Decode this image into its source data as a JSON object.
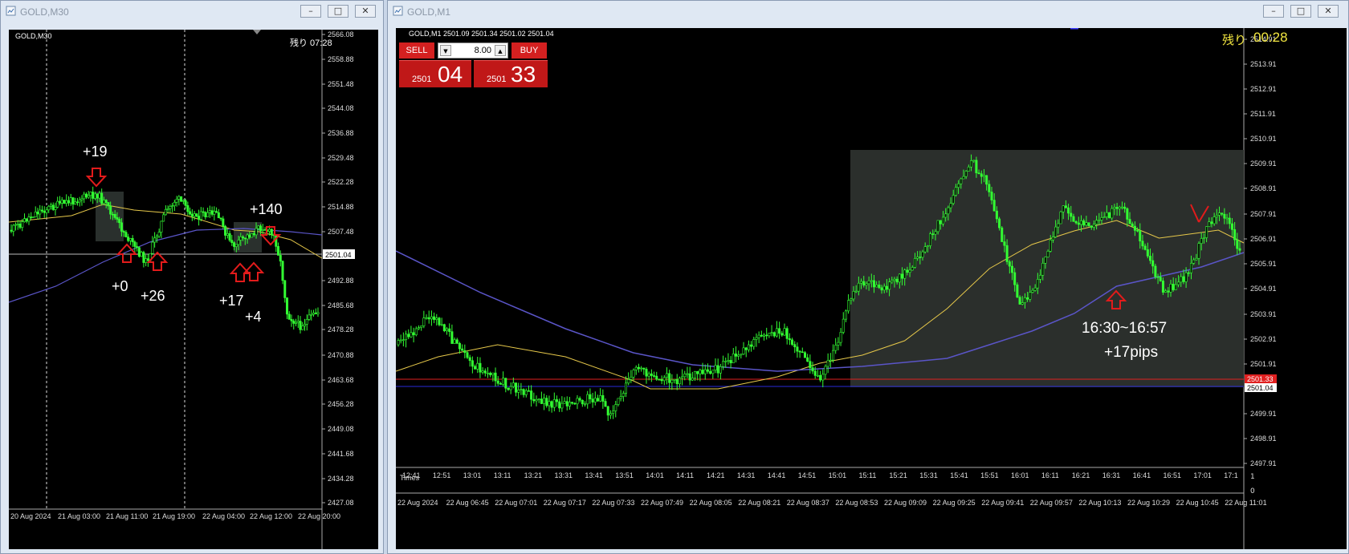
{
  "left_window": {
    "title": "GOLD,M30",
    "chart_label": "GOLD,M30",
    "remaining": "残り 07:28",
    "price_ticks": [
      "2566.08",
      "2558.88",
      "2551.48",
      "2544.08",
      "2536.88",
      "2529.48",
      "2522.28",
      "2514.88",
      "2507.48",
      "2492.88",
      "2485.68",
      "2478.28",
      "2470.88",
      "2463.68",
      "2456.28",
      "2449.08",
      "2441.68",
      "2434.28",
      "2427.08"
    ],
    "current_price": "2501.04",
    "time_ticks": [
      "20 Aug 2024",
      "21 Aug 03:00",
      "21 Aug 11:00",
      "21 Aug 19:00",
      "22 Aug 04:00",
      "22 Aug 12:00",
      "22 Aug 20:00"
    ],
    "annotations": [
      "+19",
      "+0",
      "+26",
      "+140",
      "+17",
      "+4"
    ]
  },
  "right_window": {
    "title": "GOLD,M1",
    "chart_label": "GOLD,M1  2501.09 2501.34 2501.02 2501.04",
    "remaining_label": "残り",
    "remaining_time": "00:28",
    "trade": {
      "sell_label": "SELL",
      "buy_label": "BUY",
      "lot": "8.00",
      "sell_small": "2501",
      "sell_big": "04",
      "buy_small": "2501",
      "buy_big": "33"
    },
    "price_ticks": [
      "2514.91",
      "2513.91",
      "2512.91",
      "2511.91",
      "2510.91",
      "2509.91",
      "2508.91",
      "2507.91",
      "2506.91",
      "2505.91",
      "2504.91",
      "2503.91",
      "2502.91",
      "2501.91",
      "2499.91",
      "2498.91",
      "2497.91"
    ],
    "ask_price": "2501.33",
    "bid_price": "2501.04",
    "session_ticks": [
      "12:41",
      "12:51",
      "13:01",
      "13:11",
      "13:21",
      "13:31",
      "13:41",
      "13:51",
      "14:01",
      "14:11",
      "14:21",
      "14:31",
      "14:41",
      "14:51",
      "15:01",
      "15:11",
      "15:21",
      "15:31",
      "15:41",
      "15:51",
      "16:01",
      "16:11",
      "16:21",
      "16:31",
      "16:41",
      "16:51",
      "17:01",
      "17:1"
    ],
    "times_label": "Times",
    "time_ticks": [
      "22 Aug 2024",
      "22 Aug 06:45",
      "22 Aug 07:01",
      "22 Aug 07:17",
      "22 Aug 07:33",
      "22 Aug 07:49",
      "22 Aug 08:05",
      "22 Aug 08:21",
      "22 Aug 08:37",
      "22 Aug 08:53",
      "22 Aug 09:09",
      "22 Aug 09:25",
      "22 Aug 09:41",
      "22 Aug 09:57",
      "22 Aug 10:13",
      "22 Aug 10:29",
      "22 Aug 10:45",
      "22 Aug 11:01"
    ],
    "annotation_range": "16:30~16:57",
    "annotation_pips": "+17pips",
    "indicator_ticks": [
      "1",
      "0"
    ]
  },
  "colors": {
    "candle": "#33ff33",
    "ma_fast": "#e6c84a",
    "ma_slow": "#5a55c8",
    "bid_line": "#2a2ad8",
    "ask_line": "#e02020",
    "arrow": "#e21b1b"
  }
}
